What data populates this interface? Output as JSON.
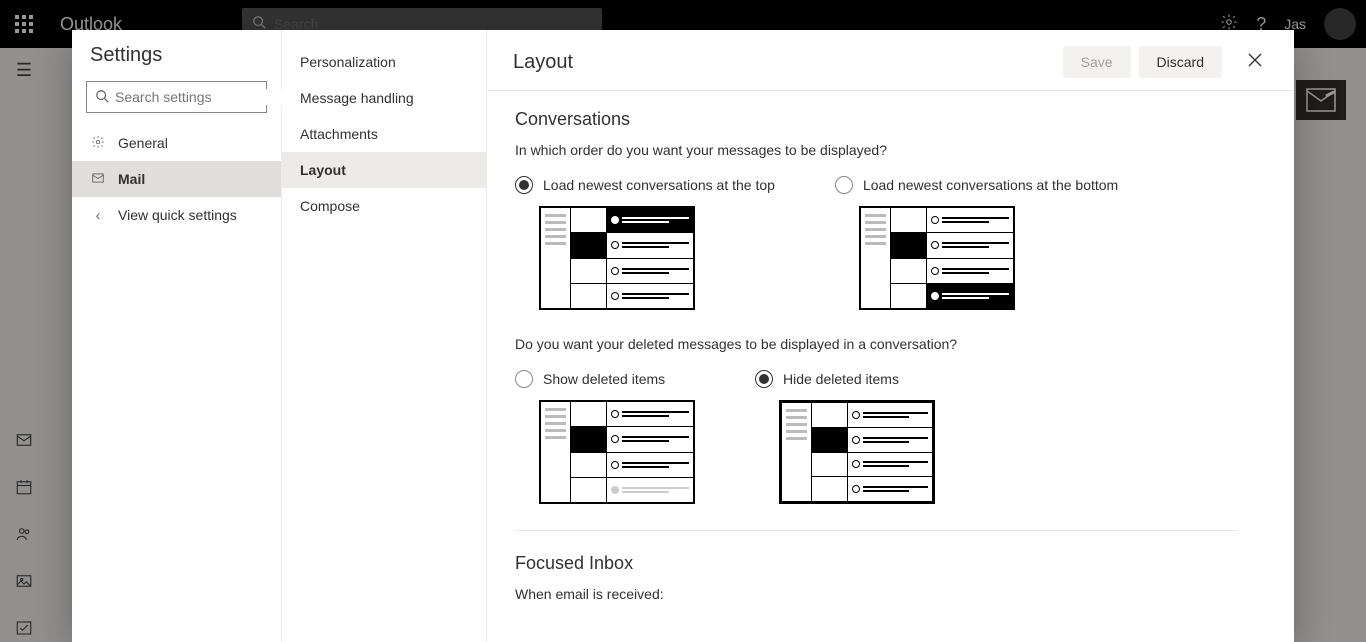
{
  "topbar": {
    "app": "Outlook",
    "search_placeholder": "Search",
    "username": "Jas"
  },
  "settings": {
    "title": "Settings",
    "search_placeholder": "Search settings",
    "nav": [
      {
        "label": "General",
        "icon": "gear"
      },
      {
        "label": "Mail",
        "icon": "mail",
        "active": true
      },
      {
        "label": "View quick settings",
        "icon": "chevron-left"
      }
    ],
    "subnav": [
      {
        "label": "Personalization"
      },
      {
        "label": "Message handling"
      },
      {
        "label": "Attachments"
      },
      {
        "label": "Layout",
        "active": true
      },
      {
        "label": "Compose"
      }
    ]
  },
  "panel": {
    "title": "Layout",
    "save": "Save",
    "discard": "Discard",
    "conversations": {
      "heading": "Conversations",
      "q1": "In which order do you want your messages to be displayed?",
      "opt1a": "Load newest conversations at the top",
      "opt1b": "Load newest conversations at the bottom",
      "q2": "Do you want your deleted messages to be displayed in a conversation?",
      "opt2a": "Show deleted items",
      "opt2b": "Hide deleted items"
    },
    "focused": {
      "heading": "Focused Inbox",
      "q": "When email is received:"
    }
  }
}
